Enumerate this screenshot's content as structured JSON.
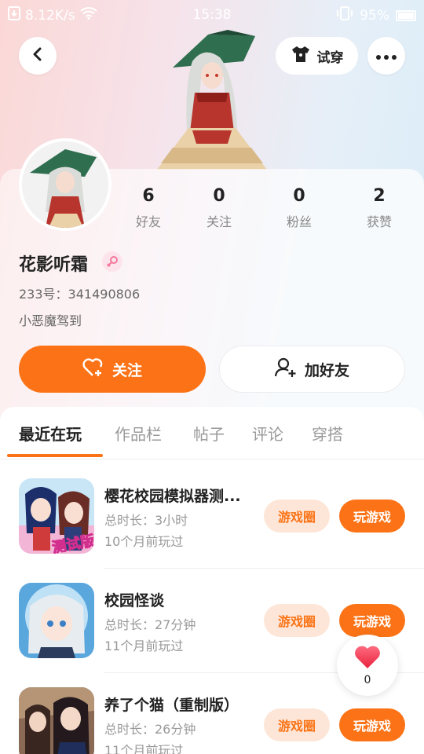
{
  "status_bar": {
    "net_speed": "8.12K/s",
    "time": "15:38",
    "battery": "95%"
  },
  "header": {
    "try_on_label": "试穿"
  },
  "profile": {
    "stats": [
      {
        "value": "6",
        "label": "好友"
      },
      {
        "value": "0",
        "label": "关注"
      },
      {
        "value": "0",
        "label": "粉丝"
      },
      {
        "value": "2",
        "label": "获赞"
      }
    ],
    "username": "花影听霜",
    "uid": "233号：341490806",
    "bio": "小恶魔驾到",
    "follow_label": "关注",
    "add_friend_label": "加好友"
  },
  "tabs": [
    "最近在玩",
    "作品栏",
    "帖子",
    "评论",
    "穿搭"
  ],
  "games": [
    {
      "title": "樱花校园模拟器测...",
      "duration": "总时长：3小时",
      "last_played": "10个月前玩过",
      "circle_label": "游戏圈",
      "play_label": "玩游戏"
    },
    {
      "title": "校园怪谈",
      "duration": "总时长：27分钟",
      "last_played": "11个月前玩过",
      "circle_label": "游戏圈",
      "play_label": "玩游戏"
    },
    {
      "title": "养了个猫（重制版）",
      "duration": "总时长：26分钟",
      "last_played": "11个月前玩过",
      "circle_label": "游戏圈",
      "play_label": "玩游戏"
    }
  ],
  "game_icon_text": {
    "first_badge": "测试版"
  },
  "like_fab": {
    "count": "0"
  },
  "colors": {
    "accent": "#fb7316",
    "accent_light": "#fde6d8"
  }
}
